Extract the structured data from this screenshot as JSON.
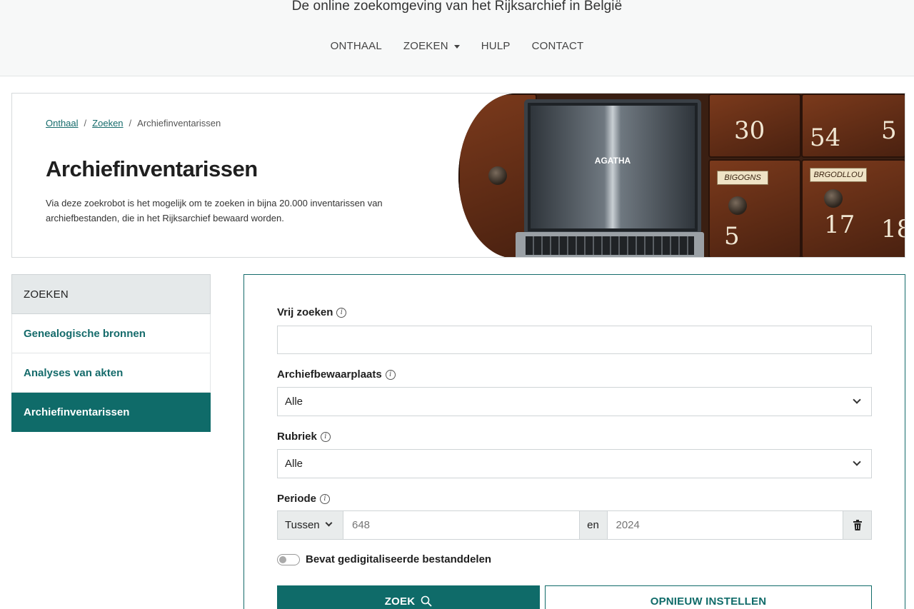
{
  "header": {
    "tagline": "De online zoekomgeving van het Rijksarchief in België",
    "nav": [
      {
        "label": "ONTHAAL"
      },
      {
        "label": "ZOEKEN"
      },
      {
        "label": "HULP"
      },
      {
        "label": "CONTACT"
      }
    ]
  },
  "hero": {
    "breadcrumb": [
      {
        "label": "Onthaal"
      },
      {
        "label": "Zoeken"
      },
      {
        "label": "Archiefinventarissen"
      }
    ],
    "title": "Archiefinventarissen",
    "description": "Via deze zoekrobot is het mogelijk om te zoeken in bijna 20.000 inventarissen van archiefbestanden, die in het Rijksarchief bewaard worden.",
    "image": {
      "screen_text": "AGATHA",
      "drawer_numbers": [
        "30",
        "54",
        "5",
        "17",
        "18",
        "5"
      ],
      "drawer_labels": [
        "BIGOGNS",
        "BRGODLLOU"
      ]
    }
  },
  "sidebar": {
    "header": "ZOEKEN",
    "items": [
      {
        "label": "Genealogische bronnen"
      },
      {
        "label": "Analyses van akten"
      },
      {
        "label": "Archiefinventarissen"
      }
    ]
  },
  "form": {
    "vrij_zoeken": {
      "label": "Vrij zoeken",
      "value": "",
      "placeholder": ""
    },
    "archiefbewaarplaats": {
      "label": "Archiefbewaarplaats",
      "value": "Alle"
    },
    "rubriek": {
      "label": "Rubriek",
      "value": "Alle"
    },
    "periode": {
      "label": "Periode",
      "mode": "Tussen",
      "from_placeholder": "648",
      "connector": "en",
      "to_placeholder": "2024"
    },
    "digitized_toggle": {
      "label": "Bevat gedigitaliseerde bestanddelen",
      "checked": false
    },
    "search_button": "ZOEK",
    "reset_button": "OPNIEUW INSTELLEN"
  },
  "colors": {
    "accent": "#0f6b69",
    "header_bg": "#f7f8f8",
    "sidebar_header_bg": "#e5e9ea"
  }
}
